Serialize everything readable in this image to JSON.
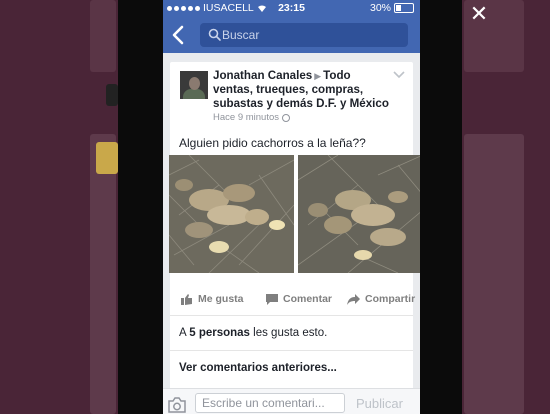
{
  "status_bar": {
    "carrier": "IUSACELL",
    "time": "23:15",
    "battery": "30%",
    "battery_level": 0.3
  },
  "search": {
    "placeholder": "Buscar"
  },
  "post": {
    "author": "Jonathan Canales",
    "group": "Todo ventas, trueques, compras, subastas y demás D.F. y México",
    "time_ago": "Hace 9 minutos",
    "text": "Alguien pidio cachorros a la leña??",
    "actions": {
      "like": "Me gusta",
      "comment": "Comentar",
      "share": "Compartir"
    },
    "likes": {
      "prefix": "A ",
      "count": "5 personas",
      "suffix": " les gusta esto."
    },
    "previous_comments": "Ver comentarios anteriores..."
  },
  "composer": {
    "placeholder": "Escribe un comentari...",
    "publish": "Publicar"
  },
  "colors": {
    "facebook_blue": "#4267b2",
    "background": "#4a2537"
  }
}
